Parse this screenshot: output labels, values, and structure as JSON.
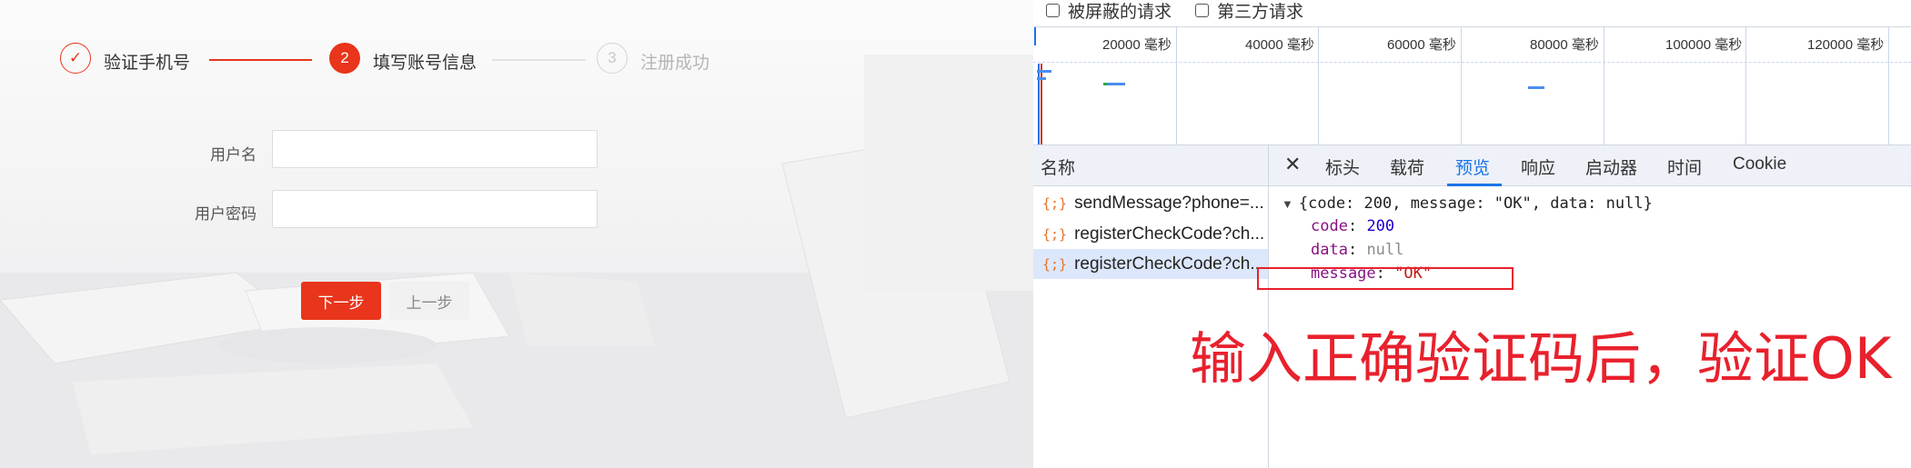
{
  "colors": {
    "accent_red": "#e8351b",
    "step_done": "#e8351b",
    "step_inactive": "#c9c9c9",
    "devtools_link": "#1a73e8",
    "json_key": "#881280",
    "json_number": "#1c00cf",
    "json_string": "#c41a16",
    "annotation_red": "#e8212d"
  },
  "steps": [
    {
      "number": "✓",
      "label": "验证手机号",
      "status": "done"
    },
    {
      "number": "2",
      "label": "填写账号信息",
      "status": "active"
    },
    {
      "number": "3",
      "label": "注册成功",
      "status": "pending"
    }
  ],
  "form": {
    "username_label": "用户名",
    "password_label": "用户密码",
    "username_value": "",
    "password_value": "",
    "next_button": "下一步",
    "prev_button": "上一步"
  },
  "devtools": {
    "filters": {
      "blocked_requests": "被屏蔽的请求",
      "third_party_requests": "第三方请求"
    },
    "timeline_ticks": [
      "20000 毫秒",
      "40000 毫秒",
      "60000 毫秒",
      "80000 毫秒",
      "100000 毫秒",
      "120000 毫秒"
    ],
    "name_column_header": "名称",
    "tabs": [
      "标头",
      "载荷",
      "预览",
      "响应",
      "启动器",
      "时间",
      "Cookie"
    ],
    "active_tab": "预览",
    "close_glyph": "✕",
    "requests": [
      {
        "icon": "{;}",
        "name": "sendMessage?phone=..."
      },
      {
        "icon": "{;}",
        "name": "registerCheckCode?ch..."
      },
      {
        "icon": "{;}",
        "name": "registerCheckCode?ch...",
        "selected": true
      }
    ],
    "preview": {
      "summary": "{code: 200, message: \"OK\", data: null}",
      "fields": [
        {
          "key": "code",
          "value": "200",
          "type": "number"
        },
        {
          "key": "data",
          "value": "null",
          "type": "null"
        },
        {
          "key": "message",
          "value": "\"OK\"",
          "type": "string"
        }
      ]
    }
  },
  "annotation": "输入正确验证码后，验证OK"
}
